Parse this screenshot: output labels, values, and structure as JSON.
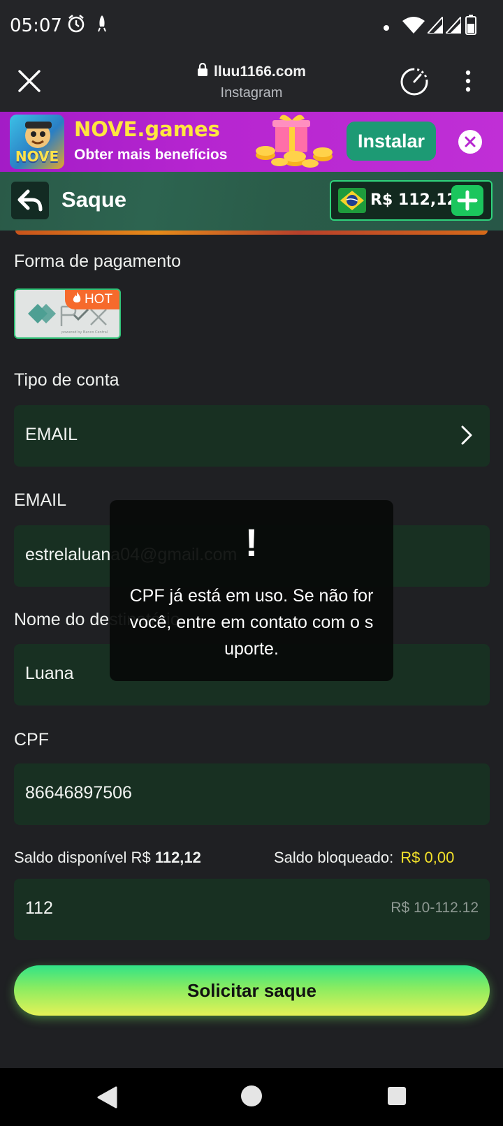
{
  "status_bar": {
    "time": "05:07"
  },
  "browser": {
    "domain": "lluu1166.com",
    "source": "Instagram"
  },
  "banner": {
    "app_name": "NOVE.games",
    "tagline": "Obter mais benefícios",
    "install_label": "Instalar",
    "icon_text": "NOVE"
  },
  "header": {
    "title": "Saque",
    "balance": "R$ 112,12"
  },
  "form": {
    "payment_label": "Forma de pagamento",
    "pix_badge": "HOT",
    "account_type_label": "Tipo de conta",
    "account_type_value": "EMAIL",
    "email_label": "EMAIL",
    "email_value": "estrelaluana04@gmail.com",
    "name_label": "Nome do destinatário",
    "name_value": "Luana",
    "cpf_label": "CPF",
    "cpf_value": "86646897506",
    "available_label": "Saldo disponível R$",
    "available_value": "112,12",
    "blocked_label": "Saldo bloqueado:",
    "blocked_value": "R$ 0,00",
    "amount_value": "112",
    "amount_range": "R$ 10-112.12",
    "submit_label": "Solicitar saque"
  },
  "toast": {
    "icon": "!",
    "message": "CPF já está em uso. Se não for você, entre em contato com o suporte."
  },
  "colors": {
    "accent_green": "#2fd27b",
    "banner_purple": "#b625d0",
    "yellow": "#f3e12a",
    "field_bg": "#183022"
  }
}
